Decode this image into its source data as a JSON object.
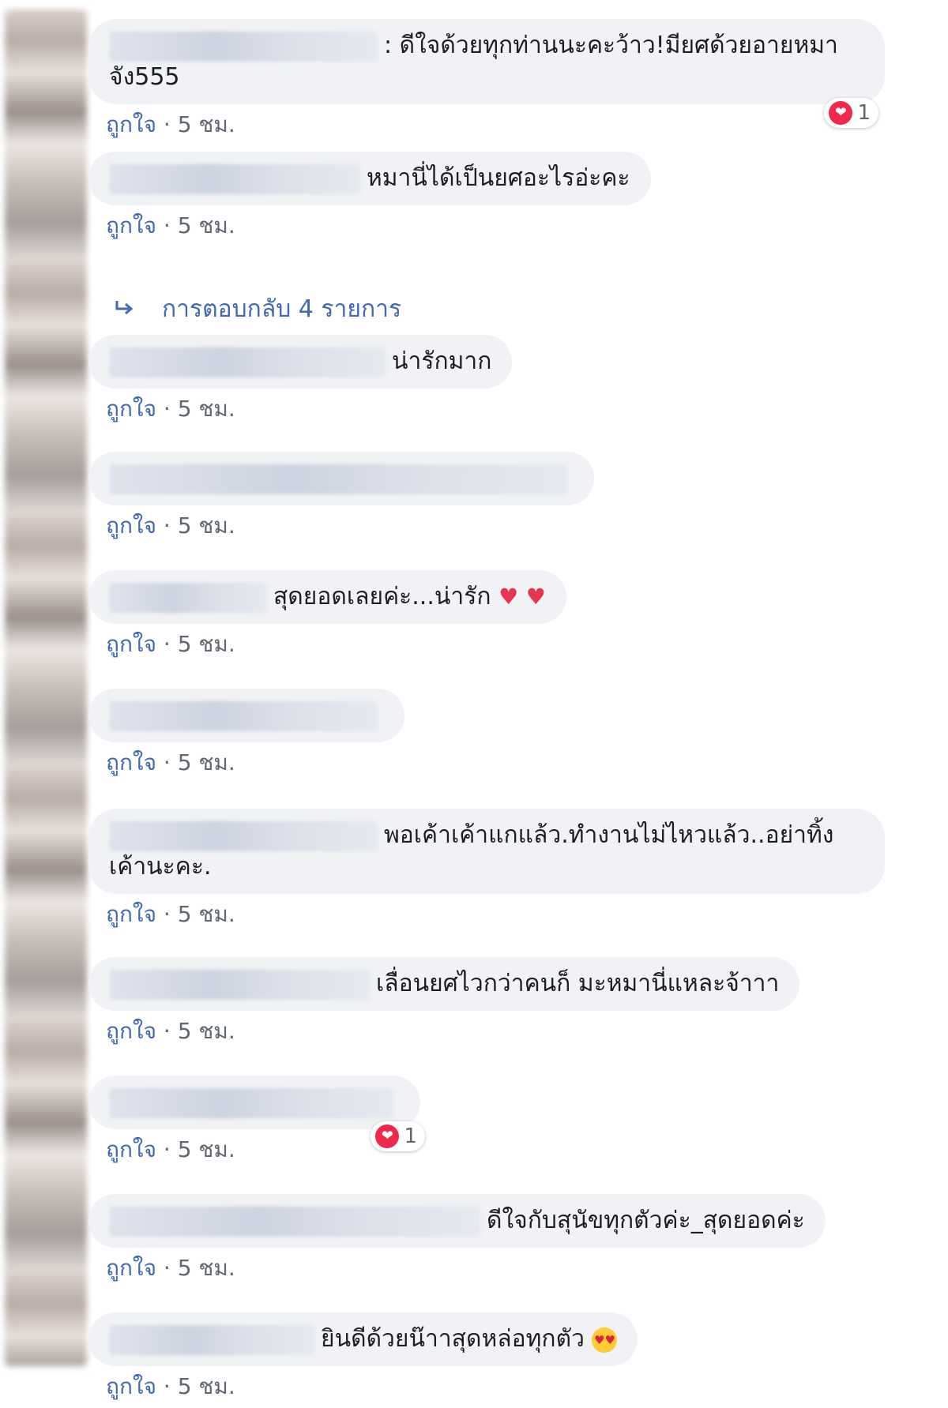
{
  "comments": [
    {
      "text": ": ดีใจด้วยทุกท่านนะคะว้าว!มียศด้วยอายหมาจัง555",
      "meta": "· 5 ชม.",
      "like": "ถูกใจ",
      "reaction_count": "1"
    },
    {
      "text": "หมานี่ได้เป็นยศอะไรอ่ะคะ",
      "meta": "· 5 ชม.",
      "like": "ถูกใจ"
    },
    {
      "text": "น่ารักมาก",
      "meta": "· 5 ชม.",
      "like": "ถูกใจ"
    },
    {
      "text": "",
      "meta": "· 5 ชม.",
      "like": "ถูกใจ"
    },
    {
      "text": "สุดยอดเลยค่ะ...น่ารัก",
      "meta": "· 5 ชม.",
      "like": "ถูกใจ"
    },
    {
      "text": "",
      "meta": "· 5 ชม.",
      "like": "ถูกใจ"
    },
    {
      "text": "พอเค้าเค้าแกแล้ว.ทำงานไม่ไหวแล้ว..อย่าทิ้งเค้านะคะ.",
      "meta": "· 5 ชม.",
      "like": "ถูกใจ"
    },
    {
      "text": "เลื่อนยศไวกว่าคนก็ มะหมานี่แหละจ้าาา",
      "meta": "· 5 ชม.",
      "like": "ถูกใจ"
    },
    {
      "text": "",
      "meta": "· 5 ชม.",
      "like": "ถูกใจ",
      "reaction_count": "1"
    },
    {
      "text": "ดีใจกับสุนัขทุกตัวค่ะ_สุดยอดค่ะ",
      "meta": "· 5 ชม.",
      "like": "ถูกใจ"
    },
    {
      "text": "ยินดีด้วยน๊าาสุดหล่อทุกตัว",
      "meta": "· 5 ชม.",
      "like": "ถูกใจ"
    }
  ],
  "replies": {
    "label": "การตอบกลับ 4 รายการ",
    "icon": "reply-arrow-icon"
  },
  "colors": {
    "bubble": "#f0f2f5",
    "link": "#4267b2",
    "meta": "#606770",
    "heart": "#f0284a"
  }
}
